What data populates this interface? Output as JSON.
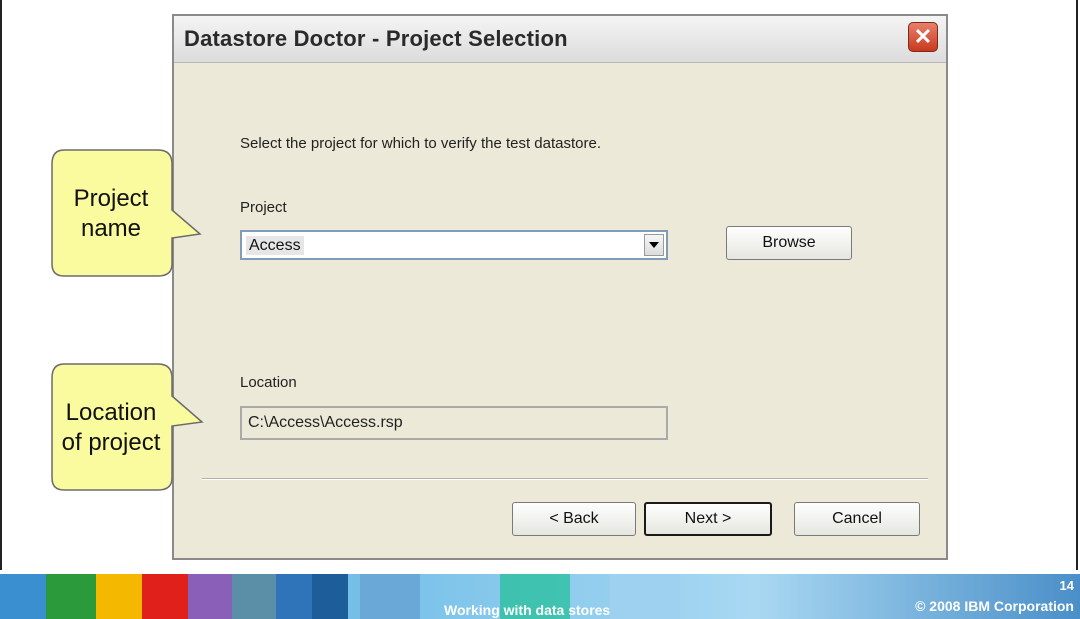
{
  "window": {
    "title": "Datastore Doctor - Project Selection",
    "close_glyph": "✕"
  },
  "form": {
    "instruction": "Select the project for which to verify the test datastore.",
    "project_label": "Project",
    "project_value": "Access",
    "browse_label": "Browse",
    "location_label": "Location",
    "location_value": "C:\\Access\\Access.rsp"
  },
  "buttons": {
    "back": "< Back",
    "next": "Next >",
    "cancel": "Cancel"
  },
  "callouts": {
    "project_line1": "Project",
    "project_line2": "name",
    "location_line1": "Location",
    "location_line2": "of project"
  },
  "footer": {
    "title": "Working with data stores",
    "page_number": "14",
    "copyright": "© 2008 IBM Corporation"
  },
  "colors": {
    "callout_fill": "#fafa9e",
    "dialog_bg": "#ece9d8",
    "close_button": "#c9391e"
  },
  "icons": [
    "close-icon",
    "dropdown-arrow-icon"
  ]
}
